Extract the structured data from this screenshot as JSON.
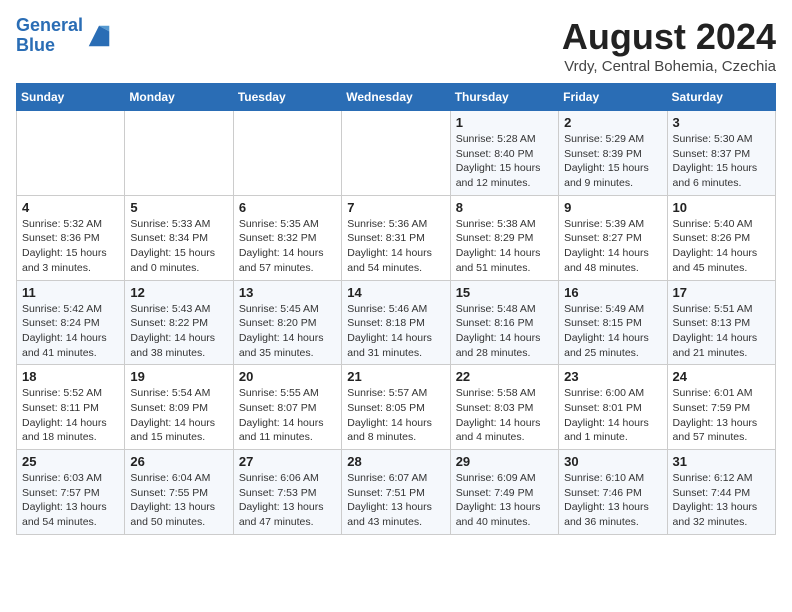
{
  "header": {
    "logo_line1": "General",
    "logo_line2": "Blue",
    "month_year": "August 2024",
    "location": "Vrdy, Central Bohemia, Czechia"
  },
  "weekdays": [
    "Sunday",
    "Monday",
    "Tuesday",
    "Wednesday",
    "Thursday",
    "Friday",
    "Saturday"
  ],
  "weeks": [
    [
      {
        "day": "",
        "info": ""
      },
      {
        "day": "",
        "info": ""
      },
      {
        "day": "",
        "info": ""
      },
      {
        "day": "",
        "info": ""
      },
      {
        "day": "1",
        "info": "Sunrise: 5:28 AM\nSunset: 8:40 PM\nDaylight: 15 hours\nand 12 minutes."
      },
      {
        "day": "2",
        "info": "Sunrise: 5:29 AM\nSunset: 8:39 PM\nDaylight: 15 hours\nand 9 minutes."
      },
      {
        "day": "3",
        "info": "Sunrise: 5:30 AM\nSunset: 8:37 PM\nDaylight: 15 hours\nand 6 minutes."
      }
    ],
    [
      {
        "day": "4",
        "info": "Sunrise: 5:32 AM\nSunset: 8:36 PM\nDaylight: 15 hours\nand 3 minutes."
      },
      {
        "day": "5",
        "info": "Sunrise: 5:33 AM\nSunset: 8:34 PM\nDaylight: 15 hours\nand 0 minutes."
      },
      {
        "day": "6",
        "info": "Sunrise: 5:35 AM\nSunset: 8:32 PM\nDaylight: 14 hours\nand 57 minutes."
      },
      {
        "day": "7",
        "info": "Sunrise: 5:36 AM\nSunset: 8:31 PM\nDaylight: 14 hours\nand 54 minutes."
      },
      {
        "day": "8",
        "info": "Sunrise: 5:38 AM\nSunset: 8:29 PM\nDaylight: 14 hours\nand 51 minutes."
      },
      {
        "day": "9",
        "info": "Sunrise: 5:39 AM\nSunset: 8:27 PM\nDaylight: 14 hours\nand 48 minutes."
      },
      {
        "day": "10",
        "info": "Sunrise: 5:40 AM\nSunset: 8:26 PM\nDaylight: 14 hours\nand 45 minutes."
      }
    ],
    [
      {
        "day": "11",
        "info": "Sunrise: 5:42 AM\nSunset: 8:24 PM\nDaylight: 14 hours\nand 41 minutes."
      },
      {
        "day": "12",
        "info": "Sunrise: 5:43 AM\nSunset: 8:22 PM\nDaylight: 14 hours\nand 38 minutes."
      },
      {
        "day": "13",
        "info": "Sunrise: 5:45 AM\nSunset: 8:20 PM\nDaylight: 14 hours\nand 35 minutes."
      },
      {
        "day": "14",
        "info": "Sunrise: 5:46 AM\nSunset: 8:18 PM\nDaylight: 14 hours\nand 31 minutes."
      },
      {
        "day": "15",
        "info": "Sunrise: 5:48 AM\nSunset: 8:16 PM\nDaylight: 14 hours\nand 28 minutes."
      },
      {
        "day": "16",
        "info": "Sunrise: 5:49 AM\nSunset: 8:15 PM\nDaylight: 14 hours\nand 25 minutes."
      },
      {
        "day": "17",
        "info": "Sunrise: 5:51 AM\nSunset: 8:13 PM\nDaylight: 14 hours\nand 21 minutes."
      }
    ],
    [
      {
        "day": "18",
        "info": "Sunrise: 5:52 AM\nSunset: 8:11 PM\nDaylight: 14 hours\nand 18 minutes."
      },
      {
        "day": "19",
        "info": "Sunrise: 5:54 AM\nSunset: 8:09 PM\nDaylight: 14 hours\nand 15 minutes."
      },
      {
        "day": "20",
        "info": "Sunrise: 5:55 AM\nSunset: 8:07 PM\nDaylight: 14 hours\nand 11 minutes."
      },
      {
        "day": "21",
        "info": "Sunrise: 5:57 AM\nSunset: 8:05 PM\nDaylight: 14 hours\nand 8 minutes."
      },
      {
        "day": "22",
        "info": "Sunrise: 5:58 AM\nSunset: 8:03 PM\nDaylight: 14 hours\nand 4 minutes."
      },
      {
        "day": "23",
        "info": "Sunrise: 6:00 AM\nSunset: 8:01 PM\nDaylight: 14 hours\nand 1 minute."
      },
      {
        "day": "24",
        "info": "Sunrise: 6:01 AM\nSunset: 7:59 PM\nDaylight: 13 hours\nand 57 minutes."
      }
    ],
    [
      {
        "day": "25",
        "info": "Sunrise: 6:03 AM\nSunset: 7:57 PM\nDaylight: 13 hours\nand 54 minutes."
      },
      {
        "day": "26",
        "info": "Sunrise: 6:04 AM\nSunset: 7:55 PM\nDaylight: 13 hours\nand 50 minutes."
      },
      {
        "day": "27",
        "info": "Sunrise: 6:06 AM\nSunset: 7:53 PM\nDaylight: 13 hours\nand 47 minutes."
      },
      {
        "day": "28",
        "info": "Sunrise: 6:07 AM\nSunset: 7:51 PM\nDaylight: 13 hours\nand 43 minutes."
      },
      {
        "day": "29",
        "info": "Sunrise: 6:09 AM\nSunset: 7:49 PM\nDaylight: 13 hours\nand 40 minutes."
      },
      {
        "day": "30",
        "info": "Sunrise: 6:10 AM\nSunset: 7:46 PM\nDaylight: 13 hours\nand 36 minutes."
      },
      {
        "day": "31",
        "info": "Sunrise: 6:12 AM\nSunset: 7:44 PM\nDaylight: 13 hours\nand 32 minutes."
      }
    ]
  ]
}
